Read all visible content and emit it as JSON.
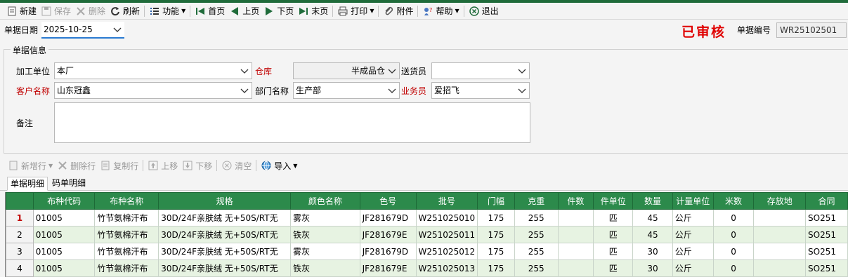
{
  "toolbar": {
    "new": "新建",
    "save": "保存",
    "delete": "删除",
    "refresh": "刷新",
    "function": "功能",
    "first": "首页",
    "prev": "上页",
    "next": "下页",
    "last": "末页",
    "print": "打印",
    "attach": "附件",
    "help": "帮助",
    "exit": "退出"
  },
  "header": {
    "date_label": "单据日期",
    "date_value": "2025-10-25",
    "status_stamp": "已审核",
    "doc_no_label": "单据编号",
    "doc_no_value": "WR25102501"
  },
  "info": {
    "title": "单据信息",
    "process_unit_label": "加工单位",
    "process_unit_value": "本厂",
    "warehouse_label": "仓库",
    "warehouse_value": "半成品仓",
    "deliverer_label": "送货员",
    "deliverer_value": "",
    "customer_label": "客户名称",
    "customer_value": "山东冠鑫",
    "dept_label": "部门名称",
    "dept_value": "生产部",
    "salesman_label": "业务员",
    "salesman_value": "爱招飞",
    "remark_label": "备注",
    "remark_value": ""
  },
  "subtoolbar": {
    "add_row": "新增行",
    "delete_row": "删除行",
    "copy_row": "复制行",
    "move_up": "上移",
    "move_down": "下移",
    "clear": "清空",
    "import": "导入"
  },
  "tabs": [
    "单据明细",
    "码单明细"
  ],
  "grid": {
    "columns": [
      "布种代码",
      "布种名称",
      "规格",
      "颜色名称",
      "色号",
      "批号",
      "门幅",
      "克重",
      "件数",
      "件单位",
      "数量",
      "计量单位",
      "米数",
      "存放地",
      "合同"
    ],
    "rows": [
      {
        "idx": "1",
        "code": "01005",
        "name": "竹节氨棉汗布",
        "spec": "30D/24F亲肤绒 无+50S/RT无",
        "color": "雾灰",
        "color_no": "JF281679D",
        "batch": "W251025010",
        "width": "175",
        "gsm": "255",
        "pieces": "",
        "piece_unit": "匹",
        "qty": "45",
        "unit": "公斤",
        "meters": "0",
        "location": "",
        "contract": "SO251"
      },
      {
        "idx": "2",
        "code": "01005",
        "name": "竹节氨棉汗布",
        "spec": "30D/24F亲肤绒 无+50S/RT无",
        "color": "铁灰",
        "color_no": "JF281679E",
        "batch": "W251025011",
        "width": "175",
        "gsm": "255",
        "pieces": "",
        "piece_unit": "匹",
        "qty": "45",
        "unit": "公斤",
        "meters": "0",
        "location": "",
        "contract": "SO251"
      },
      {
        "idx": "3",
        "code": "01005",
        "name": "竹节氨棉汗布",
        "spec": "30D/24F亲肤绒 无+50S/RT无",
        "color": "雾灰",
        "color_no": "JF281679D",
        "batch": "W251025012",
        "width": "175",
        "gsm": "255",
        "pieces": "",
        "piece_unit": "匹",
        "qty": "30",
        "unit": "公斤",
        "meters": "0",
        "location": "",
        "contract": "SO251"
      },
      {
        "idx": "4",
        "code": "01005",
        "name": "竹节氨棉汗布",
        "spec": "30D/24F亲肤绒 无+50S/RT无",
        "color": "铁灰",
        "color_no": "JF281679E",
        "batch": "W251025013",
        "width": "175",
        "gsm": "255",
        "pieces": "",
        "piece_unit": "匹",
        "qty": "30",
        "unit": "公斤",
        "meters": "0",
        "location": "",
        "contract": "SO251"
      }
    ]
  },
  "colors": {
    "header_green": "#2c8a4b",
    "row_alt": "#e7f3e2",
    "required_red": "#c00000",
    "stamp_red": "#e00000",
    "focus_blue": "#2a7ad1"
  }
}
